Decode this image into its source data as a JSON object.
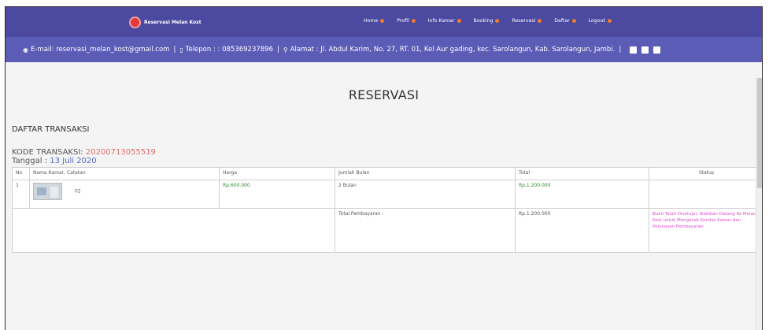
{
  "navbar": {
    "brand": "Reservasi Melan Kost",
    "items": [
      {
        "label": "Home"
      },
      {
        "label": "Profil"
      },
      {
        "label": "Info Kamar"
      },
      {
        "label": "Booking"
      },
      {
        "label": "Reservasi"
      },
      {
        "label": "Daftar"
      },
      {
        "label": "Logout"
      }
    ]
  },
  "infobar": {
    "email": "E-mail: reservasi_melan_kost@gmail.com",
    "phone": "Telepon : : 085369237896",
    "address": "Alamat : Jl. Abdul Karim, No. 27, RT. 01, Kel Aur gading, kec. Sarolangun, Kab. Sarolangun, Jambi."
  },
  "page": {
    "title": "RESERVASI",
    "section": "DAFTAR TRANSAKSI",
    "code_label": "KODE TRANSAKSI:",
    "code_value": "20200713055519",
    "date_label": "Tanggal :",
    "date_value": "13 Juli 2020"
  },
  "table": {
    "headers": [
      "No",
      "Nama Kamar, Catatan",
      "Harga",
      "Jumlah Bulan",
      "Total",
      "Status"
    ],
    "row": {
      "no": "1",
      "room": "02",
      "price": "Rp.600.000",
      "months": "2 Bulan",
      "total": "Rp.1.200.000"
    },
    "summary": {
      "label": "Total Pembayaran :",
      "total": "Rp.1.200.000",
      "status": "Bukti Telah Disetujui, Silahkan Datang Ke Melan Kost untuk Mengecek Kondisi Kamar dan Pelunasan Pembayaran."
    }
  },
  "colors": {
    "navbar": "#4b4aa0",
    "infobar": "#5b5cb6",
    "code": "#e26b6b",
    "date": "#5a67c6",
    "price": "#2c8a2c",
    "status": "#e04ac8"
  }
}
